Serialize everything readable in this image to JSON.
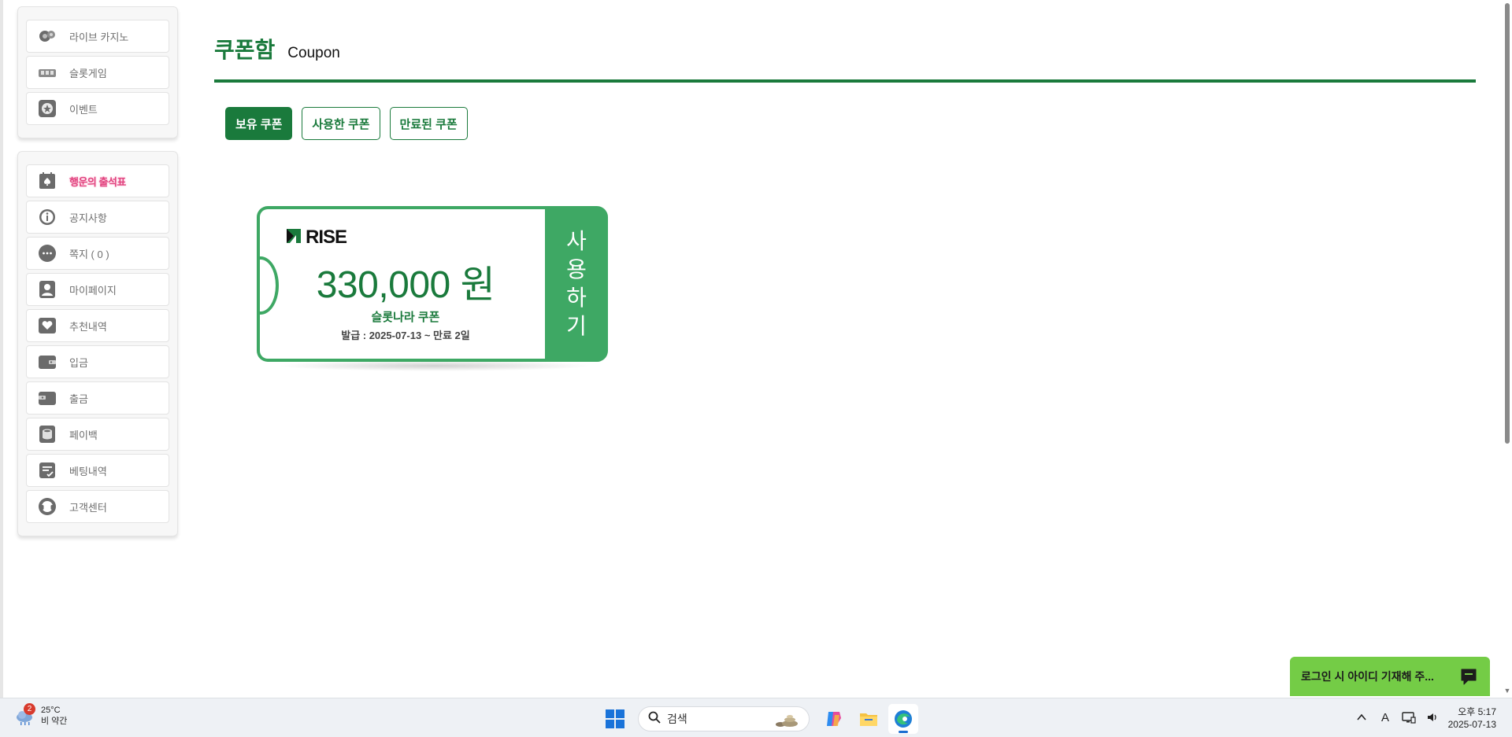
{
  "sidebar": {
    "top_items": [
      {
        "label": "라이브 카지노",
        "icon": "roulette-chips-icon"
      },
      {
        "label": "슬롯게임",
        "icon": "slot-machine-icon"
      },
      {
        "label": "이벤트",
        "icon": "event-star-icon"
      }
    ],
    "bottom_items": [
      {
        "label": "행운의 출석표",
        "icon": "calendar-spade-icon"
      },
      {
        "label": "공지사항",
        "icon": "info-icon"
      },
      {
        "label": "쪽지 ( 0 )",
        "icon": "message-bubble-icon"
      },
      {
        "label": "마이페이지",
        "icon": "user-card-icon"
      },
      {
        "label": "추천내역",
        "icon": "heart-box-icon"
      },
      {
        "label": "입금",
        "icon": "wallet-deposit-icon"
      },
      {
        "label": "출금",
        "icon": "wallet-withdraw-icon"
      },
      {
        "label": "페이백",
        "icon": "coin-stack-icon"
      },
      {
        "label": "베팅내역",
        "icon": "bet-history-icon"
      },
      {
        "label": "고객센터",
        "icon": "headset-icon"
      }
    ]
  },
  "page": {
    "title_ko": "쿠폰함",
    "title_en": "Coupon"
  },
  "tabs": [
    {
      "label": "보유 쿠폰",
      "active": true
    },
    {
      "label": "사용한 쿠폰",
      "active": false
    },
    {
      "label": "만료된 쿠폰",
      "active": false
    }
  ],
  "coupon": {
    "brand": "RISE",
    "amount": "330,000 원",
    "name": "슬롯나라 쿠폰",
    "issued": "발급 : 2025-07-13 ~ 만료 2일",
    "use_chars": [
      "사",
      "용",
      "하",
      "기"
    ]
  },
  "chat": {
    "text": "로그인 시 아이디 기재해 주..."
  },
  "taskbar": {
    "weather_temp": "25°C",
    "weather_desc": "비 약간",
    "weather_badge": "2",
    "search_placeholder": "검색",
    "clock_time": "오후 5:17",
    "clock_date": "2025-07-13",
    "ime_label": "A"
  },
  "colors": {
    "brand_green": "#1a7a3c",
    "coupon_green": "#3ea864",
    "chat_green": "#74cc46"
  }
}
